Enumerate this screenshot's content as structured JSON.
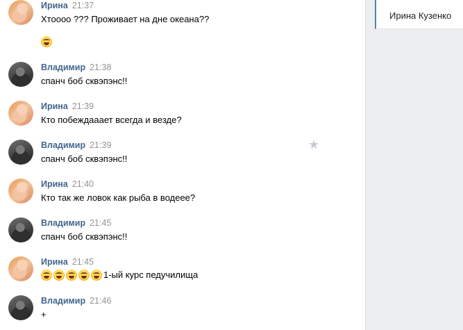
{
  "side_panel": {
    "active_tab": "Ирина Кузенко"
  },
  "messages": [
    {
      "author": "Ирина",
      "time": "21:37",
      "text": "Хтоооо ??? Проживает на дне океана??",
      "avatar": "irina",
      "extra_emoji": 1
    },
    {
      "author": "Владимир",
      "time": "21:38",
      "text": "спанч боб сквэпэнс!!",
      "avatar": "vladimir"
    },
    {
      "author": "Ирина",
      "time": "21:39",
      "text": "Кто побеждааает всегда и везде?",
      "avatar": "irina"
    },
    {
      "author": "Владимир",
      "time": "21:39",
      "text": "спанч боб сквэпэнс!!",
      "avatar": "vladimir"
    },
    {
      "author": "Ирина",
      "time": "21:40",
      "text": "Кто так же ловок как рыба в водеее?",
      "avatar": "irina"
    },
    {
      "author": "Владимир",
      "time": "21:45",
      "text": "спанч боб сквэпэнс!!",
      "avatar": "vladimir"
    },
    {
      "author": "Ирина",
      "time": "21:45",
      "text": "1-ый курс педучилища",
      "avatar": "irina",
      "leading_emoji": 5
    },
    {
      "author": "Владимир",
      "time": "21:46",
      "text": "+",
      "avatar": "vladimir"
    }
  ],
  "icons": {
    "emoji": "face-with-tears-of-joy-icon",
    "star": "star-icon"
  },
  "colors": {
    "author": "#42648b",
    "time": "#939393",
    "accent": "#5181b8",
    "panel_bg": "#edeef0"
  }
}
